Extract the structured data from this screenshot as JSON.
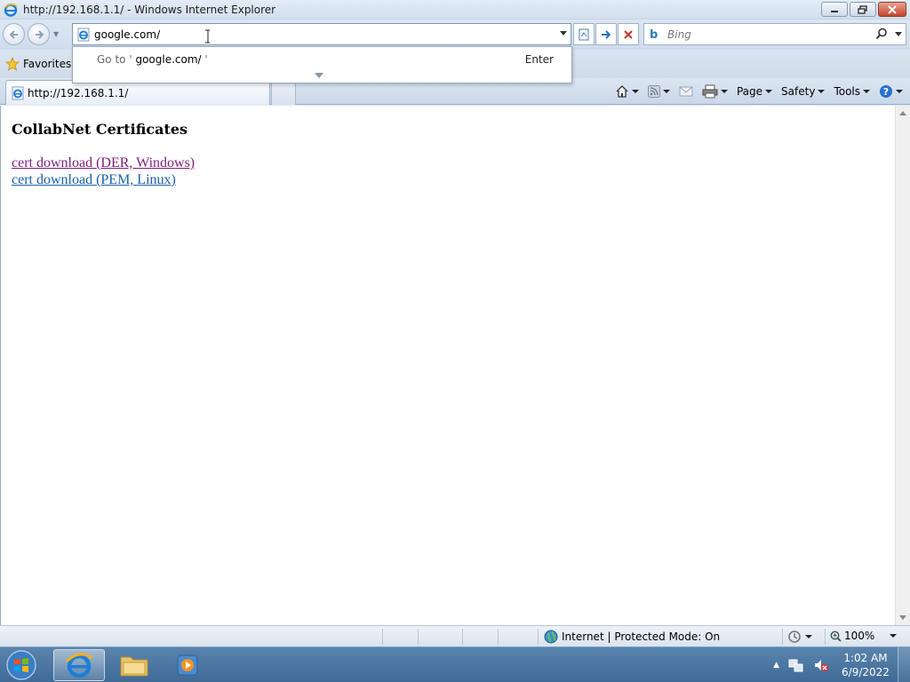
{
  "window": {
    "title": "http://192.168.1.1/ - Windows Internet Explorer"
  },
  "address_bar": {
    "value": "google.com/"
  },
  "search": {
    "placeholder": "Bing"
  },
  "autocomplete": {
    "goto_prefix": "Go to '",
    "goto_value": "google.com/",
    "goto_suffix": "'",
    "enter_label": "Enter"
  },
  "favorites": {
    "label": "Favorites"
  },
  "tab": {
    "label": "http://192.168.1.1/"
  },
  "commands": {
    "page": "Page",
    "safety": "Safety",
    "tools": "Tools"
  },
  "content": {
    "heading": "CollabNet Certificates",
    "links": [
      {
        "label": "cert download (DER, Windows)",
        "visited": true
      },
      {
        "label": "cert download (PEM, Linux)",
        "visited": false
      }
    ]
  },
  "status": {
    "zone": "Internet | Protected Mode: On",
    "zoom": "100%"
  },
  "taskbar": {
    "time": "1:02 AM",
    "date": "6/9/2022"
  },
  "colors": {
    "visited_link": "#7a1e7a",
    "link": "#1c5fa8",
    "taskbar": "#3f6a97"
  }
}
